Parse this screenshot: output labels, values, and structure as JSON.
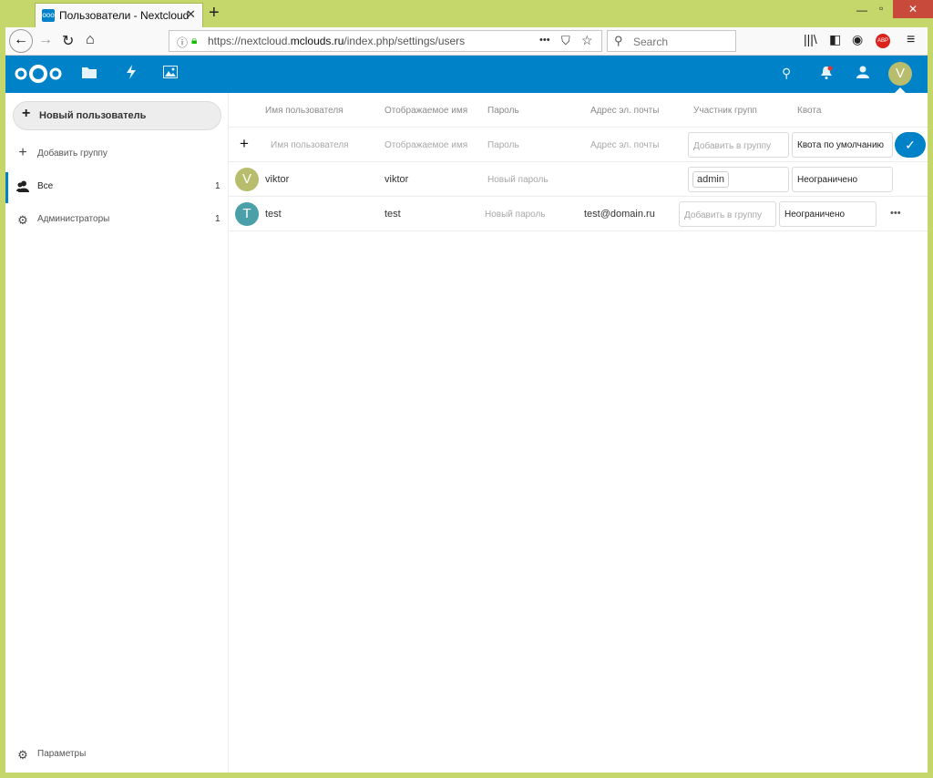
{
  "browser": {
    "tab_title": "Пользователи - Nextcloud",
    "url_prefix": "https://nextcloud.",
    "url_domain": "mclouds.ru",
    "url_path": "/index.php/settings/users",
    "search_placeholder": "Search",
    "more_glyph": "•••"
  },
  "nc": {
    "avatar_letter": "V",
    "brand_color": "#0082c9"
  },
  "sidebar": {
    "new_user_label": "Новый пользователь",
    "add_group_label": "Добавить группу",
    "items": [
      {
        "label": "Все",
        "count": "1"
      },
      {
        "label": "Администраторы",
        "count": "1"
      }
    ],
    "settings_label": "Параметры"
  },
  "table": {
    "headers": [
      "Имя пользователя",
      "Отображаемое имя",
      "Пароль",
      "Адрес эл. почты",
      "Участник групп",
      "Квота"
    ],
    "new_row": {
      "username_ph": "Имя пользователя",
      "displayname_ph": "Отображаемое имя",
      "password_ph": "Пароль",
      "email_ph": "Адрес эл. почты",
      "groups_ph": "Добавить в группу",
      "quota_value": "Квота по умолчанию"
    },
    "rows": [
      {
        "avatar": "V",
        "avatar_color": "#b8bd6e",
        "username": "viktor",
        "displayname": "viktor",
        "password_ph": "Новый пароль",
        "email": "",
        "group_tag": "admin",
        "quota": "Неограничено"
      },
      {
        "avatar": "T",
        "avatar_color": "#4a9fa8",
        "username": "test",
        "displayname": "test",
        "password_ph": "Новый пароль",
        "email": "test@domain.ru",
        "groups_ph": "Добавить в группу",
        "quota": "Неограничено",
        "more": "•••"
      }
    ]
  }
}
